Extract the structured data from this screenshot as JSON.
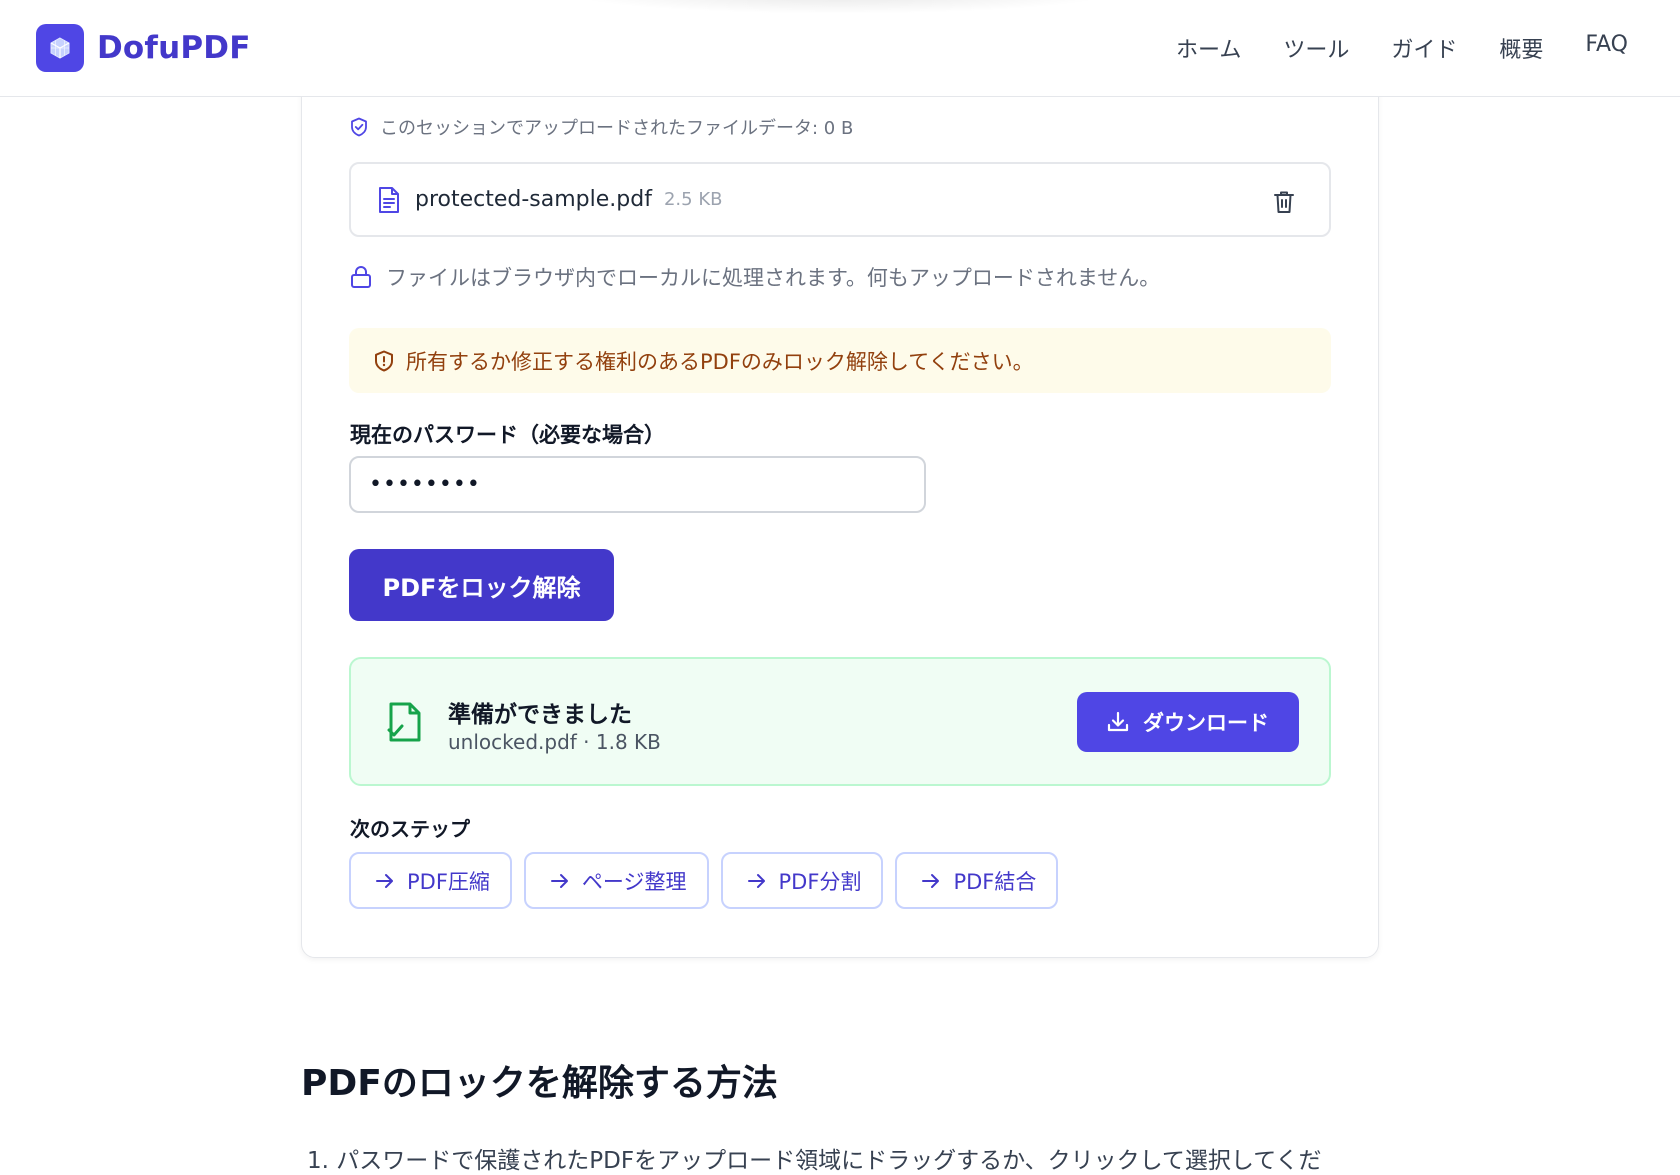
{
  "header": {
    "logo_text": "DofuPDF",
    "nav": [
      "ホーム",
      "ツール",
      "ガイド",
      "概要",
      "FAQ"
    ]
  },
  "session_note": "このセッションでアップロードされたファイルデータ: 0 B",
  "file": {
    "name": "protected-sample.pdf",
    "size": "2.5 KB"
  },
  "local_note": "ファイルはブラウザ内でローカルに処理されます。何もアップロードされません。",
  "warning": "所有するか修正する権利のあるPDFのみロック解除してください。",
  "password": {
    "label": "現在のパスワード（必要な場合）",
    "value": "••••••••"
  },
  "unlock_button": "PDFをロック解除",
  "result": {
    "title": "準備ができました",
    "file": "unlocked.pdf · 1.8 KB",
    "download_label": "ダウンロード"
  },
  "next_steps": {
    "title": "次のステップ",
    "items": [
      "PDF圧縮",
      "ページ整理",
      "PDF分割",
      "PDF結合"
    ]
  },
  "how_to": {
    "title": "PDFのロックを解除する方法",
    "step1": "1. パスワードで保護されたPDFをアップロード領域にドラッグするか、クリックして選択してくだ"
  },
  "colors": {
    "brand": "#4338ca",
    "accent": "#4f46e5",
    "success_bg": "#f0fdf4",
    "success_icon": "#16a34a",
    "warning_bg": "#fefbea",
    "warning_text": "#92400e"
  }
}
